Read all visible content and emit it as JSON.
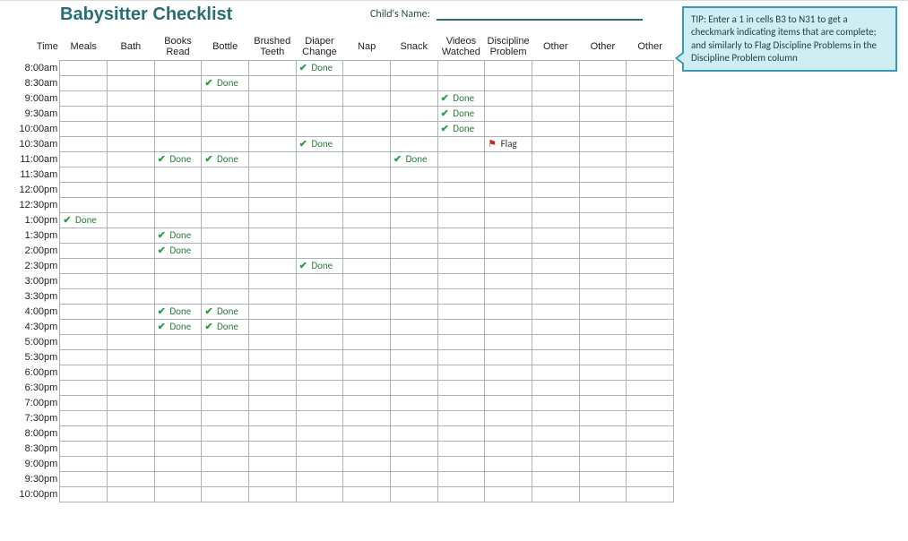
{
  "title": "Babysitter Checklist",
  "childname_label": "Child's Name:",
  "childname_value": "",
  "tip": "TIP: Enter a 1 in cells B3 to N31 to get a checkmark indicating items that are complete; and similarly to Flag Discipline Problems in the Discipline Problem column",
  "columns": [
    "Time",
    "Meals",
    "Bath",
    "Books Read",
    "Bottle",
    "Brushed Teeth",
    "Diaper Change",
    "Nap",
    "Snack",
    "Videos Watched",
    "Discipline Problem",
    "Other",
    "Other",
    "Other"
  ],
  "word_done": "Done",
  "word_flag": "Flag",
  "rows": [
    {
      "time": "8:00am",
      "cells": [
        "",
        "",
        "",
        "",
        "",
        "done",
        "",
        "",
        "",
        "",
        "",
        "",
        ""
      ]
    },
    {
      "time": "8:30am",
      "cells": [
        "",
        "",
        "",
        "done",
        "",
        "",
        "",
        "",
        "",
        "",
        "",
        "",
        ""
      ]
    },
    {
      "time": "9:00am",
      "cells": [
        "",
        "",
        "",
        "",
        "",
        "",
        "",
        "",
        "done",
        "",
        "",
        "",
        ""
      ]
    },
    {
      "time": "9:30am",
      "cells": [
        "",
        "",
        "",
        "",
        "",
        "",
        "",
        "",
        "done",
        "",
        "",
        "",
        ""
      ]
    },
    {
      "time": "10:00am",
      "cells": [
        "",
        "",
        "",
        "",
        "",
        "",
        "",
        "",
        "done",
        "",
        "",
        "",
        ""
      ]
    },
    {
      "time": "10:30am",
      "cells": [
        "",
        "",
        "",
        "",
        "",
        "done",
        "",
        "",
        "",
        "flag",
        "",
        "",
        ""
      ]
    },
    {
      "time": "11:00am",
      "cells": [
        "",
        "",
        "done",
        "done",
        "",
        "",
        "",
        "done",
        "",
        "",
        "",
        "",
        ""
      ]
    },
    {
      "time": "11:30am",
      "cells": [
        "",
        "",
        "",
        "",
        "",
        "",
        "",
        "",
        "",
        "",
        "",
        "",
        ""
      ]
    },
    {
      "time": "12:00pm",
      "cells": [
        "",
        "",
        "",
        "",
        "",
        "",
        "",
        "",
        "",
        "",
        "",
        "",
        ""
      ]
    },
    {
      "time": "12:30pm",
      "cells": [
        "",
        "",
        "",
        "",
        "",
        "",
        "",
        "",
        "",
        "",
        "",
        "",
        ""
      ]
    },
    {
      "time": "1:00pm",
      "cells": [
        "done",
        "",
        "",
        "",
        "",
        "",
        "",
        "",
        "",
        "",
        "",
        "",
        ""
      ]
    },
    {
      "time": "1:30pm",
      "cells": [
        "",
        "",
        "done",
        "",
        "",
        "",
        "",
        "",
        "",
        "",
        "",
        "",
        ""
      ]
    },
    {
      "time": "2:00pm",
      "cells": [
        "",
        "",
        "done",
        "",
        "",
        "",
        "",
        "",
        "",
        "",
        "",
        "",
        ""
      ]
    },
    {
      "time": "2:30pm",
      "cells": [
        "",
        "",
        "",
        "",
        "",
        "done",
        "",
        "",
        "",
        "",
        "",
        "",
        ""
      ]
    },
    {
      "time": "3:00pm",
      "cells": [
        "",
        "",
        "",
        "",
        "",
        "",
        "",
        "",
        "",
        "",
        "",
        "",
        ""
      ]
    },
    {
      "time": "3:30pm",
      "cells": [
        "",
        "",
        "",
        "",
        "",
        "",
        "",
        "",
        "",
        "",
        "",
        "",
        ""
      ]
    },
    {
      "time": "4:00pm",
      "cells": [
        "",
        "",
        "done",
        "done",
        "",
        "",
        "",
        "",
        "",
        "",
        "",
        "",
        ""
      ]
    },
    {
      "time": "4:30pm",
      "cells": [
        "",
        "",
        "done",
        "done",
        "",
        "",
        "",
        "",
        "",
        "",
        "",
        "",
        ""
      ]
    },
    {
      "time": "5:00pm",
      "cells": [
        "",
        "",
        "",
        "",
        "",
        "",
        "",
        "",
        "",
        "",
        "",
        "",
        ""
      ]
    },
    {
      "time": "5:30pm",
      "cells": [
        "",
        "",
        "",
        "",
        "",
        "",
        "",
        "",
        "",
        "",
        "",
        "",
        ""
      ]
    },
    {
      "time": "6:00pm",
      "cells": [
        "",
        "",
        "",
        "",
        "",
        "",
        "",
        "",
        "",
        "",
        "",
        "",
        ""
      ]
    },
    {
      "time": "6:30pm",
      "cells": [
        "",
        "",
        "",
        "",
        "",
        "",
        "",
        "",
        "",
        "",
        "",
        "",
        ""
      ]
    },
    {
      "time": "7:00pm",
      "cells": [
        "",
        "",
        "",
        "",
        "",
        "",
        "",
        "",
        "",
        "",
        "",
        "",
        ""
      ]
    },
    {
      "time": "7:30pm",
      "cells": [
        "",
        "",
        "",
        "",
        "",
        "",
        "",
        "",
        "",
        "",
        "",
        "",
        ""
      ]
    },
    {
      "time": "8:00pm",
      "cells": [
        "",
        "",
        "",
        "",
        "",
        "",
        "",
        "",
        "",
        "",
        "",
        "",
        ""
      ]
    },
    {
      "time": "8:30pm",
      "cells": [
        "",
        "",
        "",
        "",
        "",
        "",
        "",
        "",
        "",
        "",
        "",
        "",
        ""
      ]
    },
    {
      "time": "9:00pm",
      "cells": [
        "",
        "",
        "",
        "",
        "",
        "",
        "",
        "",
        "",
        "",
        "",
        "",
        ""
      ]
    },
    {
      "time": "9:30pm",
      "cells": [
        "",
        "",
        "",
        "",
        "",
        "",
        "",
        "",
        "",
        "",
        "",
        "",
        ""
      ]
    },
    {
      "time": "10:00pm",
      "cells": [
        "",
        "",
        "",
        "",
        "",
        "",
        "",
        "",
        "",
        "",
        "",
        "",
        ""
      ]
    }
  ]
}
